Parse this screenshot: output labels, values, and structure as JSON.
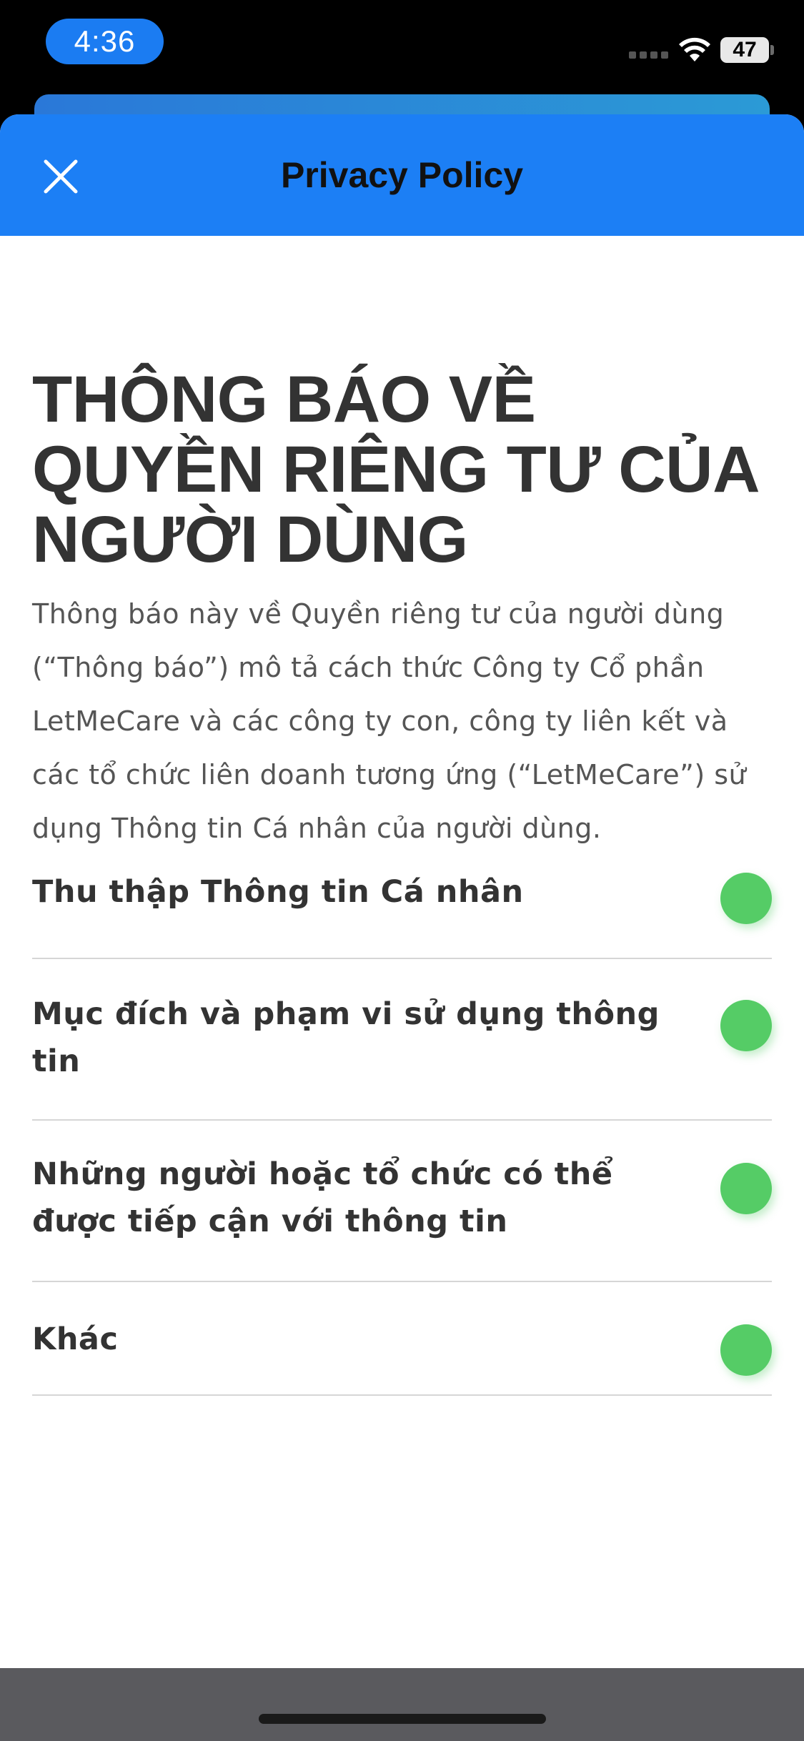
{
  "status_bar": {
    "time": "4:36",
    "battery": "47",
    "icons": [
      "signal-icon",
      "wifi-icon",
      "battery-icon"
    ]
  },
  "header": {
    "title": "Privacy Policy",
    "close_icon": "close-icon",
    "background_color": "#1c7ff5"
  },
  "main": {
    "heading": "THÔNG BÁO VỀ QUYỀN RIÊNG TƯ CỦA NGƯỜI DÙNG",
    "intro": "Thông báo này về Quyền riêng tư của người dùng (“Thông báo”) mô tả cách thức Công ty Cổ phần LetMeCare và các công ty con, công ty liên kết và các tổ chức liên doanh tương ứng (“LetMeCare”) sử dụng Thông tin Cá nhân của người dùng.",
    "sections": [
      {
        "label": "Thu thập Thông tin Cá nhân"
      },
      {
        "label": "Mục đích và phạm vi sử dụng thông tin"
      },
      {
        "label": "Những người hoặc tổ chức có thể được tiếp cận với thông tin"
      },
      {
        "label": "Khác"
      }
    ],
    "indicator_color": "#55cc66"
  }
}
